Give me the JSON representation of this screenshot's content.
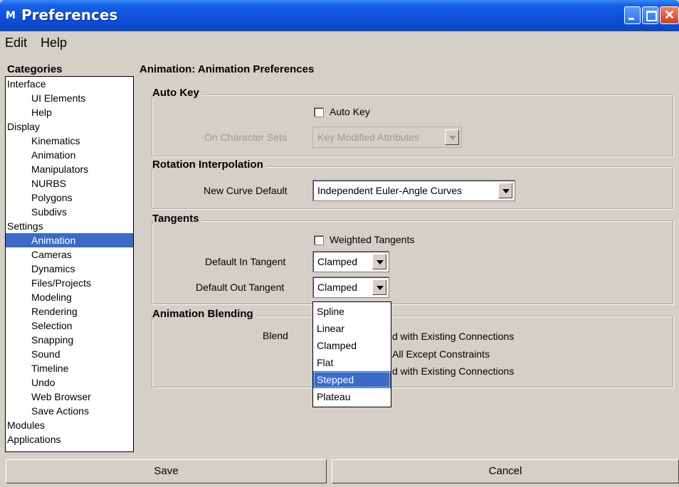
{
  "window": {
    "title": "Preferences",
    "icon": "maya-icon",
    "controls": {
      "minimize": "minimize-icon",
      "maximize": "maximize-icon",
      "close": "✕"
    }
  },
  "menubar": {
    "items": [
      "Edit",
      "Help"
    ]
  },
  "categories": {
    "label": "Categories",
    "items": [
      {
        "label": "Interface",
        "level": 0
      },
      {
        "label": "UI Elements",
        "level": 1
      },
      {
        "label": "Help",
        "level": 1
      },
      {
        "label": "Display",
        "level": 0
      },
      {
        "label": "Kinematics",
        "level": 1
      },
      {
        "label": "Animation",
        "level": 1
      },
      {
        "label": "Manipulators",
        "level": 1
      },
      {
        "label": "NURBS",
        "level": 1
      },
      {
        "label": "Polygons",
        "level": 1
      },
      {
        "label": "Subdivs",
        "level": 1
      },
      {
        "label": "Settings",
        "level": 0
      },
      {
        "label": "Animation",
        "level": 1,
        "selected": true
      },
      {
        "label": "Cameras",
        "level": 1
      },
      {
        "label": "Dynamics",
        "level": 1
      },
      {
        "label": "Files/Projects",
        "level": 1
      },
      {
        "label": "Modeling",
        "level": 1
      },
      {
        "label": "Rendering",
        "level": 1
      },
      {
        "label": "Selection",
        "level": 1
      },
      {
        "label": "Snapping",
        "level": 1
      },
      {
        "label": "Sound",
        "level": 1
      },
      {
        "label": "Timeline",
        "level": 1
      },
      {
        "label": "Undo",
        "level": 1
      },
      {
        "label": "Web Browser",
        "level": 1
      },
      {
        "label": "Save Actions",
        "level": 1
      },
      {
        "label": "Modules",
        "level": 0
      },
      {
        "label": "Applications",
        "level": 0
      }
    ]
  },
  "page": {
    "title": "Animation: Animation Preferences",
    "auto_key": {
      "title": "Auto Key",
      "checkbox_label": "Auto Key",
      "checked": false,
      "char_sets_label": "On Character Sets",
      "char_sets_value": "Key Modified Attributes"
    },
    "rotation": {
      "title": "Rotation Interpolation",
      "label": "New Curve Default",
      "value": "Independent Euler-Angle Curves"
    },
    "tangents": {
      "title": "Tangents",
      "weighted_label": "Weighted Tangents",
      "weighted_checked": false,
      "in_label": "Default In Tangent",
      "in_value": "Clamped",
      "out_label": "Default Out Tangent",
      "out_value": "Clamped"
    },
    "blending": {
      "title": "Animation Blending",
      "label": "Blend",
      "options": [
        "d with Existing Connections",
        "All Except Constraints",
        "d with Existing Connections"
      ]
    },
    "dropdown": {
      "options": [
        "Spline",
        "Linear",
        "Clamped",
        "Flat",
        "Stepped",
        "Plateau"
      ],
      "highlighted": "Stepped"
    }
  },
  "buttons": {
    "save": "Save",
    "cancel": "Cancel"
  },
  "colors": {
    "selection": "#3b6bc7",
    "titlebar": "#0f4fd6",
    "window_bg": "#d4d0c8"
  }
}
